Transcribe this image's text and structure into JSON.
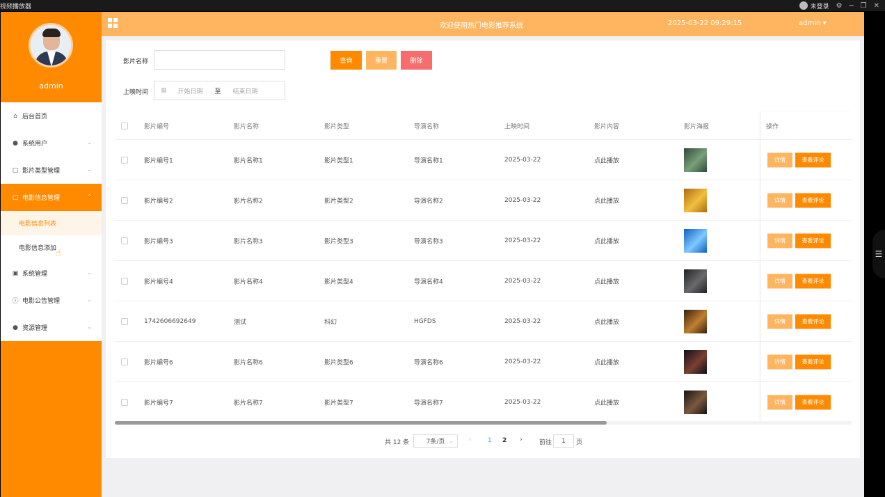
{
  "window": {
    "title": "视频播放器",
    "user": "未登录",
    "controls": [
      "⚙",
      "─",
      "❐",
      "✕"
    ]
  },
  "sidebar": {
    "username": "admin",
    "items": [
      {
        "label": "后台首页",
        "icon": "home-icon",
        "glyph": "⌂"
      },
      {
        "label": "系统用户",
        "icon": "user-icon",
        "glyph": "●"
      },
      {
        "label": "影片类型管理",
        "icon": "document-icon",
        "glyph": "▢"
      },
      {
        "label": "电影信息管理",
        "icon": "document-icon",
        "glyph": "▢"
      },
      {
        "label": "系统管理",
        "icon": "image-icon",
        "glyph": "▣"
      },
      {
        "label": "电影公告管理",
        "icon": "info-icon",
        "glyph": "ⓘ"
      },
      {
        "label": "资源管理",
        "icon": "location-icon",
        "glyph": "●"
      }
    ],
    "subitems": [
      {
        "label": "电影信息列表"
      },
      {
        "label": "电影信息添加"
      }
    ]
  },
  "header": {
    "title": "欢迎使用热门电影推荐系统",
    "datetime": "2025-03-22 09:29:15",
    "user": "admin ▾"
  },
  "search": {
    "name_label": "影片名称",
    "time_label": "上映时间",
    "start_placeholder": "开始日期",
    "to": "至",
    "end_placeholder": "结束日期",
    "query": "查询",
    "reset": "重置",
    "delete": "删除"
  },
  "table": {
    "headers": [
      "影片编号",
      "影片名称",
      "影片类型",
      "导演名称",
      "上映时间",
      "影片内容",
      "影片海报",
      "操作"
    ],
    "rows": [
      {
        "id": "影片编号1",
        "name": "影片名称1",
        "type": "影片类型1",
        "director": "导演名称1",
        "date": "2025-03-22",
        "content": "点此播放",
        "poster": [
          "#2f4a3a",
          "#7aa07a"
        ]
      },
      {
        "id": "影片编号2",
        "name": "影片名称2",
        "type": "影片类型2",
        "director": "导演名称2",
        "date": "2025-03-22",
        "content": "点此播放",
        "poster": [
          "#b06a10",
          "#f2c040"
        ]
      },
      {
        "id": "影片编号3",
        "name": "影片名称3",
        "type": "影片类型3",
        "director": "导演名称3",
        "date": "2025-03-22",
        "content": "点此播放",
        "poster": [
          "#1060c0",
          "#80c8ff"
        ]
      },
      {
        "id": "影片编号4",
        "name": "影片名称4",
        "type": "影片类型4",
        "director": "导演名称4",
        "date": "2025-03-22",
        "content": "点此播放",
        "poster": [
          "#1e2228",
          "#6a6a6a"
        ]
      },
      {
        "id": "1742606692649",
        "name": "测试",
        "type": "科幻",
        "director": "HGFDS",
        "date": "2025-03-22",
        "content": "点此播放",
        "poster": [
          "#3a2010",
          "#c08030"
        ]
      },
      {
        "id": "影片编号6",
        "name": "影片名称6",
        "type": "影片类型6",
        "director": "导演名称6",
        "date": "2025-03-22",
        "content": "点此播放",
        "poster": [
          "#101018",
          "#7a4030"
        ]
      },
      {
        "id": "影片编号7",
        "name": "影片名称7",
        "type": "影片类型7",
        "director": "导演名称7",
        "date": "2025-03-22",
        "content": "点此播放",
        "poster": [
          "#181410",
          "#7a5a40"
        ]
      }
    ],
    "detail_label": "详情",
    "comment_label": "查看评论"
  },
  "pagination": {
    "total": "共 12 条",
    "page_size": "7条/页",
    "pages": [
      "1",
      "2"
    ],
    "goto": "前往",
    "goto_value": "1",
    "page_suffix": "页"
  },
  "colors": {
    "primary": "#ff8a00",
    "light": "#ffb560",
    "danger": "#f76c6c"
  }
}
